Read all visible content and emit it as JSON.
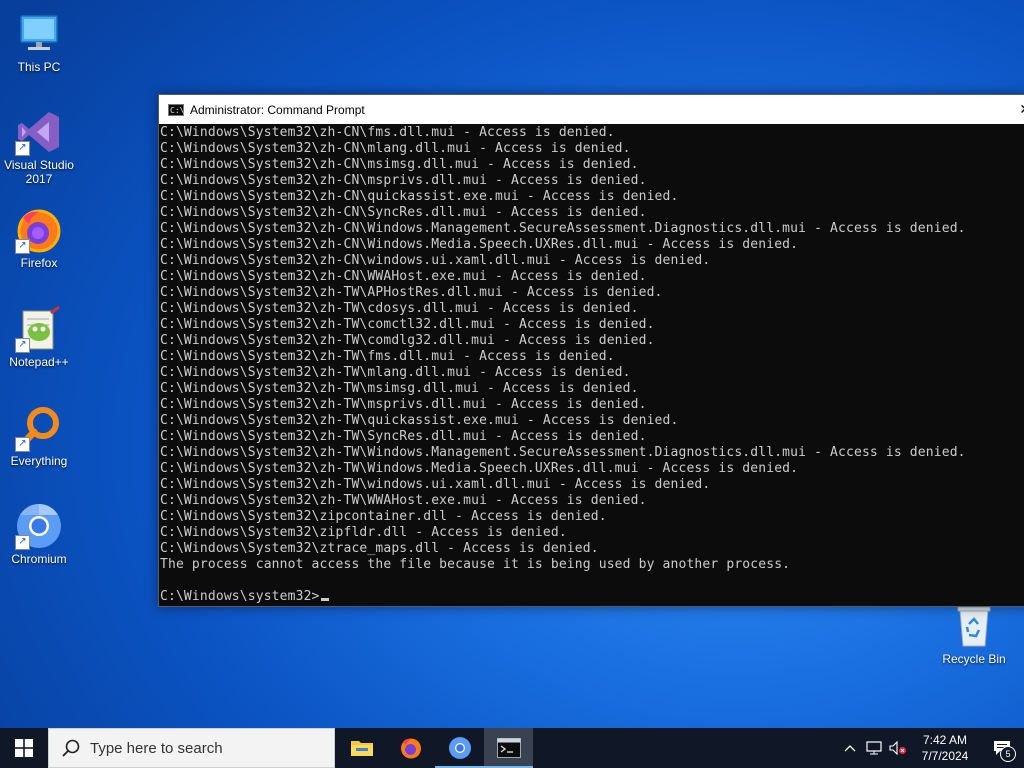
{
  "desktop": {
    "icons": [
      {
        "label": "This PC"
      },
      {
        "label": "Visual Studio 2017"
      },
      {
        "label": "Firefox"
      },
      {
        "label": "Notepad++"
      },
      {
        "label": "Everything"
      },
      {
        "label": "Chromium"
      },
      {
        "label": "Recycle Bin"
      }
    ]
  },
  "console": {
    "title": "Administrator: Command Prompt",
    "lines": [
      "C:\\Windows\\System32\\zh-CN\\fms.dll.mui - Access is denied.",
      "C:\\Windows\\System32\\zh-CN\\mlang.dll.mui - Access is denied.",
      "C:\\Windows\\System32\\zh-CN\\msimsg.dll.mui - Access is denied.",
      "C:\\Windows\\System32\\zh-CN\\msprivs.dll.mui - Access is denied.",
      "C:\\Windows\\System32\\zh-CN\\quickassist.exe.mui - Access is denied.",
      "C:\\Windows\\System32\\zh-CN\\SyncRes.dll.mui - Access is denied.",
      "C:\\Windows\\System32\\zh-CN\\Windows.Management.SecureAssessment.Diagnostics.dll.mui - Access is denied.",
      "C:\\Windows\\System32\\zh-CN\\Windows.Media.Speech.UXRes.dll.mui - Access is denied.",
      "C:\\Windows\\System32\\zh-CN\\windows.ui.xaml.dll.mui - Access is denied.",
      "C:\\Windows\\System32\\zh-CN\\WWAHost.exe.mui - Access is denied.",
      "C:\\Windows\\System32\\zh-TW\\APHostRes.dll.mui - Access is denied.",
      "C:\\Windows\\System32\\zh-TW\\cdosys.dll.mui - Access is denied.",
      "C:\\Windows\\System32\\zh-TW\\comctl32.dll.mui - Access is denied.",
      "C:\\Windows\\System32\\zh-TW\\comdlg32.dll.mui - Access is denied.",
      "C:\\Windows\\System32\\zh-TW\\fms.dll.mui - Access is denied.",
      "C:\\Windows\\System32\\zh-TW\\mlang.dll.mui - Access is denied.",
      "C:\\Windows\\System32\\zh-TW\\msimsg.dll.mui - Access is denied.",
      "C:\\Windows\\System32\\zh-TW\\msprivs.dll.mui - Access is denied.",
      "C:\\Windows\\System32\\zh-TW\\quickassist.exe.mui - Access is denied.",
      "C:\\Windows\\System32\\zh-TW\\SyncRes.dll.mui - Access is denied.",
      "C:\\Windows\\System32\\zh-TW\\Windows.Management.SecureAssessment.Diagnostics.dll.mui - Access is denied.",
      "C:\\Windows\\System32\\zh-TW\\Windows.Media.Speech.UXRes.dll.mui - Access is denied.",
      "C:\\Windows\\System32\\zh-TW\\windows.ui.xaml.dll.mui - Access is denied.",
      "C:\\Windows\\System32\\zh-TW\\WWAHost.exe.mui - Access is denied.",
      "C:\\Windows\\System32\\zipcontainer.dll - Access is denied.",
      "C:\\Windows\\System32\\zipfldr.dll - Access is denied.",
      "C:\\Windows\\System32\\ztrace_maps.dll - Access is denied.",
      "The process cannot access the file because it is being used by another process.",
      ""
    ],
    "prompt": "C:\\Windows\\system32>"
  },
  "taskbar": {
    "search_placeholder": "Type here to search",
    "apps": [
      "File Explorer",
      "Firefox",
      "Chromium",
      "Command Prompt"
    ],
    "clock_time": "7:42 AM",
    "clock_date": "7/7/2024",
    "notification_count": "5"
  },
  "colors": {
    "console_bg": "#0c0c0c",
    "console_fg": "#cccccc",
    "taskbar_bg": "#101827",
    "accent": "#76b9ed"
  }
}
